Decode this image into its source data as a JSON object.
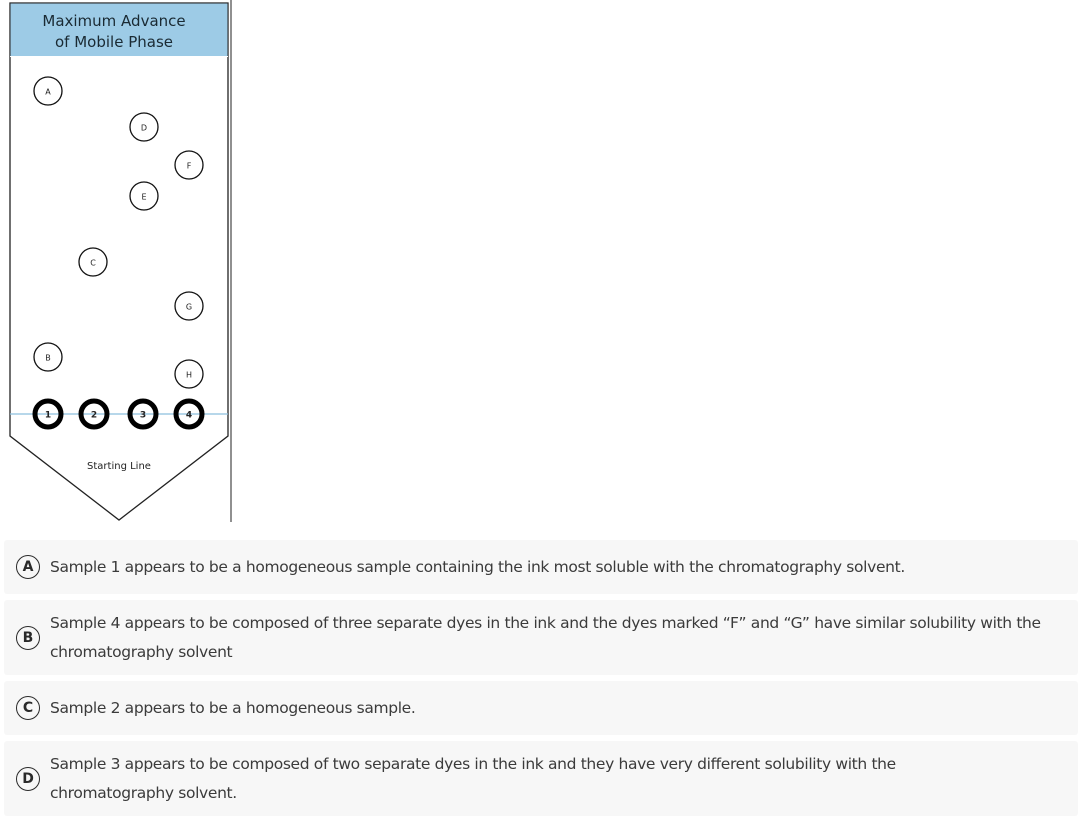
{
  "figure": {
    "header_line1": "Maximum Advance",
    "header_line2": "of Mobile Phase",
    "starting_line_label": "Starting Line",
    "colors": {
      "header_fill": "#9dcbe6",
      "start_line": "#8cbfdd",
      "ink": "#000000"
    },
    "spots": [
      {
        "label": "A"
      },
      {
        "label": "D"
      },
      {
        "label": "F"
      },
      {
        "label": "E"
      },
      {
        "label": "C"
      },
      {
        "label": "G"
      },
      {
        "label": "B"
      },
      {
        "label": "H"
      }
    ],
    "samples": [
      {
        "label": "1"
      },
      {
        "label": "2"
      },
      {
        "label": "3"
      },
      {
        "label": "4"
      }
    ]
  },
  "options": [
    {
      "letter": "A",
      "text": "Sample 1 appears to be a homogeneous sample containing the ink most soluble with the chromatography solvent."
    },
    {
      "letter": "B",
      "text": "Sample 4 appears to be composed of three separate dyes in the ink and the dyes marked “F” and “G” have similar solubility with the chromatography solvent"
    },
    {
      "letter": "C",
      "text": "Sample 2 appears to be a homogeneous sample."
    },
    {
      "letter": "D",
      "text": "Sample 3 appears to be composed of two separate dyes in the ink and they have very different solubility with the chromatography solvent."
    }
  ]
}
